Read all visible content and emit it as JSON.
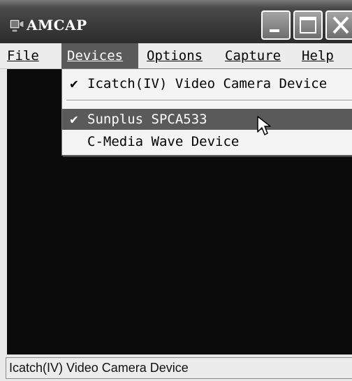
{
  "window": {
    "title": "AMCAP",
    "icon": "camera-app-icon",
    "controls": [
      "minimize-icon",
      "maximize-icon",
      "close-icon"
    ]
  },
  "menubar": {
    "file": "File",
    "devices": "Devices",
    "options": "Options",
    "capture": "Capture",
    "help": "Help"
  },
  "devices_menu": {
    "items": [
      {
        "check": "✔",
        "label": "Icatch(IV) Video Camera Device"
      },
      {
        "check": "✔",
        "label": "Sunplus SPCA533"
      },
      {
        "check": "",
        "label": "C-Media Wave Device"
      }
    ]
  },
  "status": {
    "text": "Icatch(IV) Video Camera Device"
  },
  "colors": {
    "highlight": "#5a5a5a",
    "video_bg": "#0b0b0b",
    "title_bar": "#3a3a3a"
  }
}
